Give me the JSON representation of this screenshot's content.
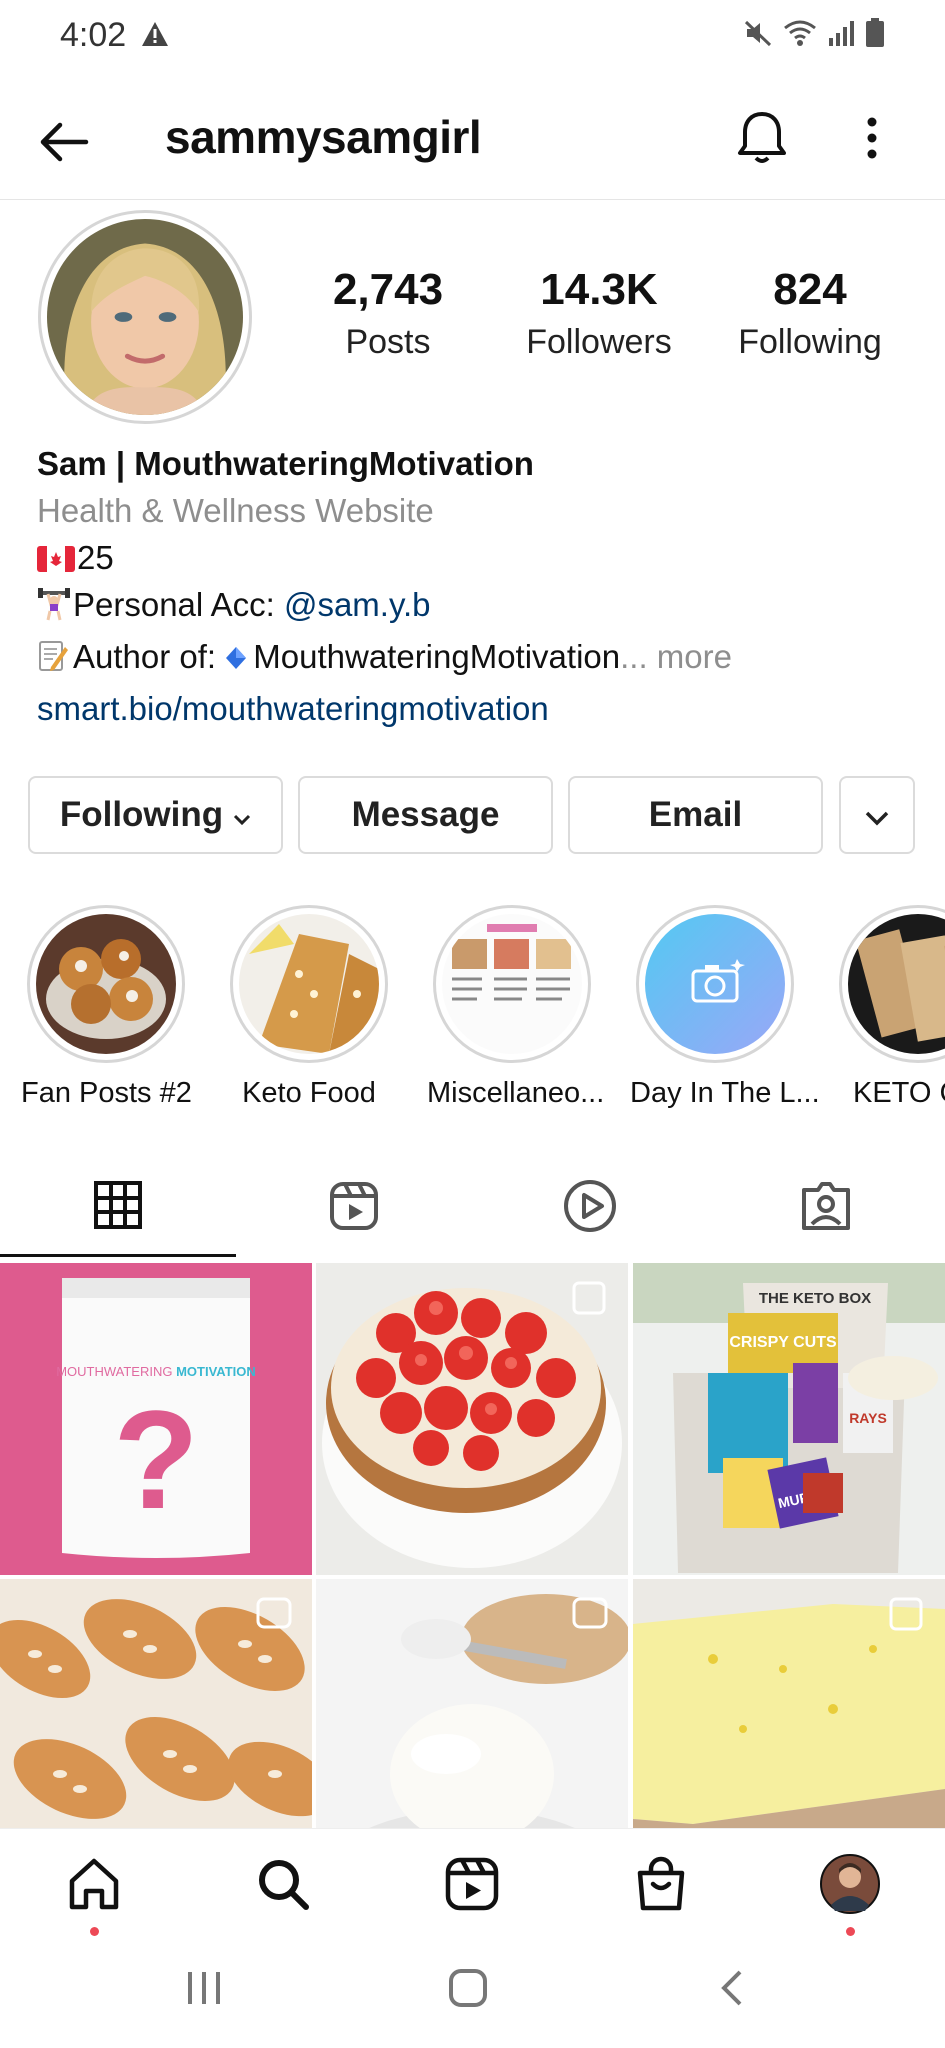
{
  "status": {
    "time": "4:02"
  },
  "header": {
    "username": "sammysamgirl"
  },
  "stats": [
    {
      "value": "2,743",
      "label": "Posts"
    },
    {
      "value": "14.3K",
      "label": "Followers"
    },
    {
      "value": "824",
      "label": "Following"
    }
  ],
  "bio": {
    "name": "Sam | MouthwateringMotivation",
    "category": "Health & Wellness Website",
    "line1": "25",
    "line2_prefix": "Personal Acc: ",
    "line2_mention": "@sam.y.b",
    "line3_prefix": "Author of: ",
    "line3_text": "MouthwateringMotivation",
    "line3_more": "... more",
    "link": "smart.bio/mouthwateringmotivation"
  },
  "actions": {
    "following": "Following",
    "message": "Message",
    "email": "Email"
  },
  "highlights": [
    {
      "label": "Fan Posts #2"
    },
    {
      "label": "Keto Food"
    },
    {
      "label": "Miscellaneo..."
    },
    {
      "label": "Day In The L..."
    },
    {
      "label": "KETO CO"
    }
  ],
  "grid_posts": [
    {
      "text": "MOUTHWATERING",
      "text2": "MOTIVATION",
      "mark": "?"
    },
    {
      "subject": "strawberry cake"
    },
    {
      "box_title": "THE KETO BOX",
      "item1": "CRISPY CUTS",
      "item2": "RAYS",
      "item3": "MUFFIN"
    },
    {
      "subject": "almond croissants"
    },
    {
      "subject": "cream dessert"
    },
    {
      "subject": "lemon cheesecake bar"
    }
  ],
  "colors": {
    "accent_pink": "#de5b8e",
    "link_blue": "#00376b",
    "notification_red": "#ed4956",
    "muted_gray": "#8e8e8e"
  }
}
